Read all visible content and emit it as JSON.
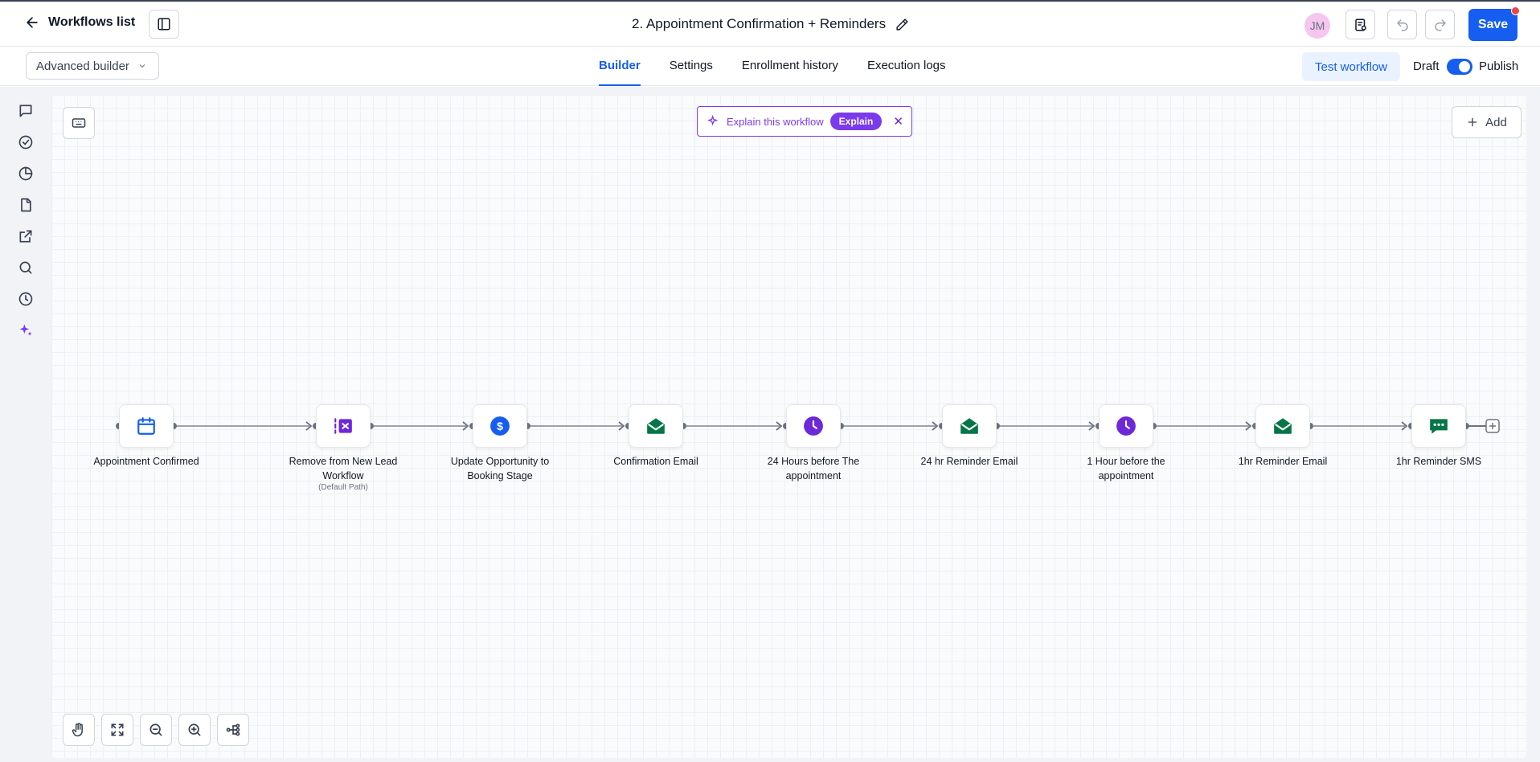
{
  "header": {
    "back_label": "Workflows list",
    "workflow_title": "2. Appointment Confirmation + Reminders",
    "avatar_initials": "JM",
    "save_label": "Save"
  },
  "subbar": {
    "builder_mode": "Advanced builder",
    "tabs": [
      {
        "label": "Builder",
        "active": true
      },
      {
        "label": "Settings",
        "active": false
      },
      {
        "label": "Enrollment history",
        "active": false
      },
      {
        "label": "Execution logs",
        "active": false
      }
    ],
    "test_label": "Test workflow",
    "draft_label": "Draft",
    "publish_label": "Publish",
    "published": true
  },
  "canvas": {
    "explain_text": "Explain this workflow",
    "explain_button": "Explain",
    "add_label": "Add"
  },
  "nodes": [
    {
      "label": "Appointment Confirmed",
      "sub": "",
      "icon": "calendar-icon",
      "color": "#155eef"
    },
    {
      "label": "Remove from New Lead Workflow",
      "sub": "(Default Path)",
      "icon": "remove-workflow-icon",
      "color": "#6d28d9"
    },
    {
      "label": "Update Opportunity to Booking Stage",
      "sub": "",
      "icon": "dollar-icon",
      "color": "#155eef"
    },
    {
      "label": "Confirmation Email",
      "sub": "",
      "icon": "email-icon",
      "color": "#067647"
    },
    {
      "label": "24 Hours before The appointment",
      "sub": "",
      "icon": "clock-icon",
      "color": "#6d28d9"
    },
    {
      "label": "24 hr Reminder Email",
      "sub": "",
      "icon": "email-icon",
      "color": "#067647"
    },
    {
      "label": "1 Hour before the appointment",
      "sub": "",
      "icon": "clock-icon",
      "color": "#6d28d9"
    },
    {
      "label": "1hr Reminder Email",
      "sub": "",
      "icon": "email-icon",
      "color": "#067647"
    },
    {
      "label": "1hr Reminder SMS",
      "sub": "",
      "icon": "sms-icon",
      "color": "#067647"
    }
  ],
  "colors": {
    "primary": "#155eef",
    "purple": "#7c3aed",
    "green": "#067647",
    "notification": "#ef4444"
  }
}
